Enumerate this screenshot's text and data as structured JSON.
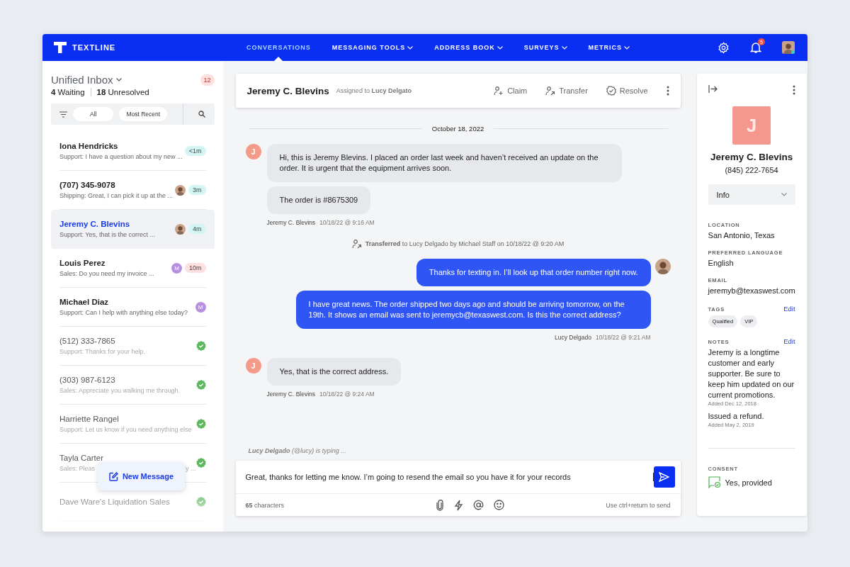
{
  "nav": {
    "logo": "TEXTLINE",
    "tabs": [
      {
        "label": "CONVERSATIONS",
        "selected": true,
        "has_menu": false
      },
      {
        "label": "MESSAGING TOOLS",
        "selected": false,
        "has_menu": true
      },
      {
        "label": "ADDRESS BOOK",
        "selected": false,
        "has_menu": true
      },
      {
        "label": "SURVEYS",
        "selected": false,
        "has_menu": true
      },
      {
        "label": "METRICS",
        "selected": false,
        "has_menu": true
      }
    ],
    "notifications": "5"
  },
  "inbox": {
    "title": "Unified Inbox",
    "count": "12",
    "stats": [
      "**4** Waiting",
      "**18** Unresolved"
    ],
    "filters": [
      "All",
      "Most Recent"
    ],
    "conversations": [
      {
        "name": "Iona Hendricks",
        "preview": "Support: I have a question about my new ...",
        "selected": false,
        "resolved": false,
        "timer": {
          "text": "<1m",
          "color": "#d3f5f3"
        }
      },
      {
        "name": "(707) 345-9078",
        "preview": "Shipping: Great, I can pick it up at the ...",
        "selected": false,
        "resolved": false,
        "assignee": {
          "kind": "photo"
        },
        "timer": {
          "text": "3m",
          "color": "#d3f5f3"
        }
      },
      {
        "name": "Jeremy C. Blevins",
        "preview": "Support: Yes, that is the correct ...",
        "selected": true,
        "resolved": false,
        "assignee": {
          "kind": "photo"
        },
        "timer": {
          "text": "4m",
          "color": "#d3f5f3"
        }
      },
      {
        "name": "Louis Perez",
        "preview": "Sales: Do you need my invoice ...",
        "selected": false,
        "resolved": false,
        "assignee": {
          "kind": "letter",
          "letter": "M"
        },
        "timer": {
          "text": "10m",
          "color": "#fde0df"
        }
      },
      {
        "name": "Michael Diaz",
        "preview": "Support: Can I help with anything else today?",
        "selected": false,
        "resolved": false,
        "assignee": {
          "kind": "letter",
          "letter": "M"
        }
      },
      {
        "name": "(512) 333-7865",
        "preview": "Support: Thanks for your help.",
        "selected": false,
        "resolved": true
      },
      {
        "name": "(303) 987-6123",
        "preview": "Sales: Appreciate you walking me through.",
        "selected": false,
        "resolved": true
      },
      {
        "name": "Harriette Rangel",
        "preview": "Support: Let us know if you need anything else",
        "selected": false,
        "resolved": true
      },
      {
        "name": "Tayla Carter",
        "preview": "Sales: Pleas",
        "preview_tail": "y ...",
        "selected": false,
        "resolved": true
      },
      {
        "name": "Dave Ware's Liquidation Sales",
        "selected": false,
        "resolved": true
      }
    ],
    "new_message": "New Message"
  },
  "conversation": {
    "name": "Jeremy C. Blevins",
    "assigned": "Assigned to **Lucy Delgato**",
    "actions": [
      {
        "kind": "claim",
        "label": "Claim"
      },
      {
        "kind": "transfer",
        "label": "Transfer"
      },
      {
        "kind": "resolve",
        "label": "Resolve"
      }
    ],
    "thread": [
      {
        "kind": "date",
        "text": "October 18, 2022"
      },
      {
        "kind": "incoming",
        "initial": "J",
        "bubbles": [
          "Hi, this is Jeremy Blevins. I placed an order last week and haven’t received an update on the order. It is urgent that the equipment arrives soon.",
          "The order is #8675309"
        ],
        "sender": "Jeremy C. Blevins",
        "time": "10/18/22 @ 9:16 AM"
      },
      {
        "kind": "event",
        "text": "**Transferred** to Lucy Delgado by Michael Staff on 10/18/22 @ 9:20 AM"
      },
      {
        "kind": "outgoing",
        "bubbles": [
          "Thanks for texting in. I’ll look up that order number right now.",
          "I have great news. The order shipped two days ago and should be arriving tomorrow, on the 19th. It shows an email was sent to jeremycb@texaswest.com. Is this the correct address?"
        ],
        "sender": "Lucy Delgado",
        "time": "10/18/22 @ 9:21 AM"
      },
      {
        "kind": "incoming",
        "initial": "J",
        "bubbles": [
          "Yes, that is the correct address."
        ],
        "sender": "Jeremy C. Blevins",
        "time": "10/18/22 @ 9:24 AM"
      }
    ],
    "typing": "**Lucy Delgado** (@lucy) is typing ...",
    "composer": {
      "value": "Great, thanks for letting me know. I’m going to resend the email so you have it for your records",
      "counter": "**65** characters",
      "hint": "Use ctrl+return to send"
    }
  },
  "contact": {
    "initial": "J",
    "name": "Jeremy C. Blevins",
    "phone": "(845) 222-7654",
    "view": "Info",
    "fields": [
      {
        "label": "LOCATION",
        "value": "San Antonio, Texas"
      },
      {
        "label": "PREFERRED LANGUAGE",
        "value": "English"
      },
      {
        "label": "EMAIL",
        "value": "jeremyb@texaswest.com"
      }
    ],
    "tags": {
      "label": "TAGS",
      "edit": "Edit",
      "items": [
        "Qualified",
        "VIP"
      ]
    },
    "notes": {
      "label": "NOTES",
      "edit": "Edit",
      "items": [
        {
          "text": "Jeremy is a longtime customer and early supporter. Be sure to keep him updated on our current promotions.",
          "added": "Added Dec 12, 2018"
        },
        {
          "text": "Issued a refund.",
          "added": "Added May 2, 2019"
        }
      ]
    },
    "consent": {
      "label": "CONSENT",
      "value": "Yes, provided"
    }
  }
}
